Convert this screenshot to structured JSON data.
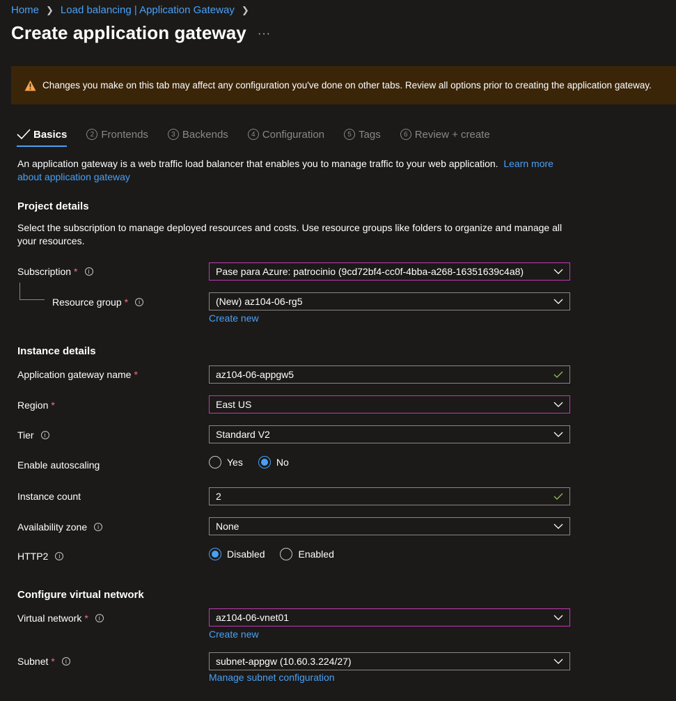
{
  "breadcrumb": {
    "items": [
      "Home",
      "Load balancing | Application Gateway"
    ]
  },
  "page": {
    "title": "Create application gateway",
    "more": "···"
  },
  "banner": {
    "message": "Changes you make on this tab may affect any configuration you've done on other tabs. Review all options prior to creating the application gateway."
  },
  "tabs": [
    {
      "num": "",
      "label": "Basics"
    },
    {
      "num": "2",
      "label": "Frontends"
    },
    {
      "num": "3",
      "label": "Backends"
    },
    {
      "num": "4",
      "label": "Configuration"
    },
    {
      "num": "5",
      "label": "Tags"
    },
    {
      "num": "6",
      "label": "Review + create"
    }
  ],
  "intro": {
    "text": "An application gateway is a web traffic load balancer that enables you to manage traffic to your web application.",
    "link": "Learn more about application gateway"
  },
  "project": {
    "heading": "Project details",
    "description": "Select the subscription to manage deployed resources and costs. Use resource groups like folders to organize and manage all your resources.",
    "subscription_label": "Subscription",
    "subscription_value": "Pase para Azure: patrocinio (9cd72bf4-cc0f-4bba-a268-16351639c4a8)",
    "rg_label": "Resource group",
    "rg_value": "(New) az104-06-rg5",
    "rg_create": "Create new"
  },
  "instance": {
    "heading": "Instance details",
    "name_label": "Application gateway name",
    "name_value": "az104-06-appgw5",
    "region_label": "Region",
    "region_value": "East US",
    "tier_label": "Tier",
    "tier_value": "Standard V2",
    "autoscale_label": "Enable autoscaling",
    "autoscale_yes": "Yes",
    "autoscale_no": "No",
    "count_label": "Instance count",
    "count_value": "2",
    "zone_label": "Availability zone",
    "zone_value": "None",
    "http2_label": "HTTP2",
    "http2_disabled": "Disabled",
    "http2_enabled": "Enabled"
  },
  "vnet": {
    "heading": "Configure virtual network",
    "vnet_label": "Virtual network",
    "vnet_value": "az104-06-vnet01",
    "vnet_create": "Create new",
    "subnet_label": "Subnet",
    "subnet_value": "subnet-appgw (10.60.3.224/27)",
    "subnet_manage": "Manage subnet configuration"
  },
  "colors": {
    "background": "#1b1a19",
    "link": "#4aa0f5",
    "banner": "#3b2509",
    "warning": "#f7a44a",
    "highlight_border": "#c239b3",
    "required": "#f1707b",
    "check": "#92c353"
  }
}
